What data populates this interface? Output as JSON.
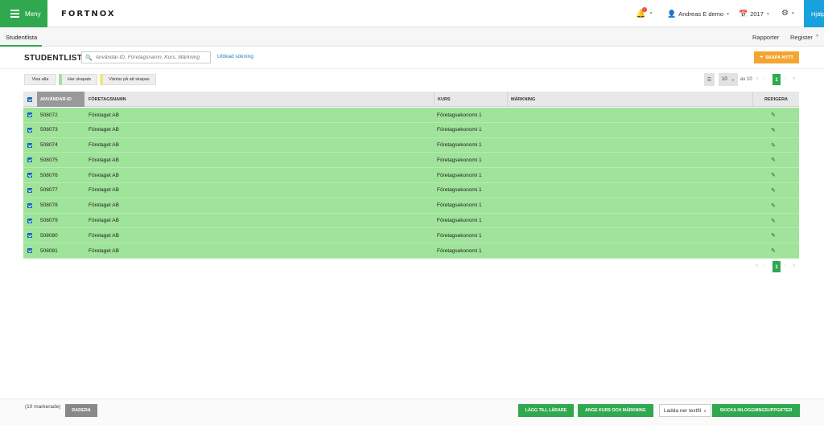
{
  "topbar": {
    "menu_label": "Meny",
    "logo": "FORTNOX",
    "notifications_count": "1",
    "user_name": "Andreas E demo",
    "year": "2017",
    "help_label": "Hjälp"
  },
  "subnav": {
    "active_tab": "Studentlista",
    "reports": "Rapporter",
    "register": "Register"
  },
  "page": {
    "title": "STUDENTLISTA",
    "search_placeholder": "Användar-ID, Företagsnamn, Kurs, Märkning",
    "advanced_search": "Utökad sökning",
    "create_button": "SKAPA NYTT"
  },
  "filters": {
    "all": "Visa alla",
    "created": "Har skapats",
    "waiting": "Väntar på att skapas"
  },
  "pagination": {
    "per_page": "10",
    "of_label": "av 10",
    "current_page": "1"
  },
  "table": {
    "columns": [
      "ANVÄNDAR-ID",
      "FÖRETAGSNAMN",
      "KURS",
      "MÄRKNING",
      "REDIGERA"
    ],
    "rows": [
      {
        "id": "508072",
        "company": "Företaget AB",
        "course": "Företagsekonomi 1",
        "mark": ""
      },
      {
        "id": "508073",
        "company": "Företaget AB",
        "course": "Företagsekonomi 1",
        "mark": ""
      },
      {
        "id": "508074",
        "company": "Företaget AB",
        "course": "Företagsekonomi 1",
        "mark": ""
      },
      {
        "id": "508075",
        "company": "Företaget AB",
        "course": "Företagsekonomi 1",
        "mark": ""
      },
      {
        "id": "508076",
        "company": "Företaget AB",
        "course": "Företagsekonomi 1",
        "mark": ""
      },
      {
        "id": "508077",
        "company": "Företaget AB",
        "course": "Företagsekonomi 1",
        "mark": ""
      },
      {
        "id": "508078",
        "company": "Företaget AB",
        "course": "Företagsekonomi 1",
        "mark": ""
      },
      {
        "id": "508079",
        "company": "Företaget AB",
        "course": "Företagsekonomi 1",
        "mark": ""
      },
      {
        "id": "508080",
        "company": "Företaget AB",
        "course": "Företagsekonomi 1",
        "mark": ""
      },
      {
        "id": "508081",
        "company": "Företaget AB",
        "course": "Företagsekonomi 1",
        "mark": ""
      }
    ]
  },
  "footer": {
    "marked_count": "(10 markerade)",
    "delete": "RADERA",
    "add_teacher": "LÄGG TILL LÄRARE",
    "set_course": "ANGE KURS OCH MÄRKNING",
    "download": "Ladda ner textfil",
    "send_login": "SKICKA INLOGGNINGSUPPGIFTER"
  },
  "colors": {
    "brand_green": "#2fa84f",
    "row_green": "#a0e39b",
    "orange": "#f3a530",
    "help_blue": "#17a2dd"
  }
}
